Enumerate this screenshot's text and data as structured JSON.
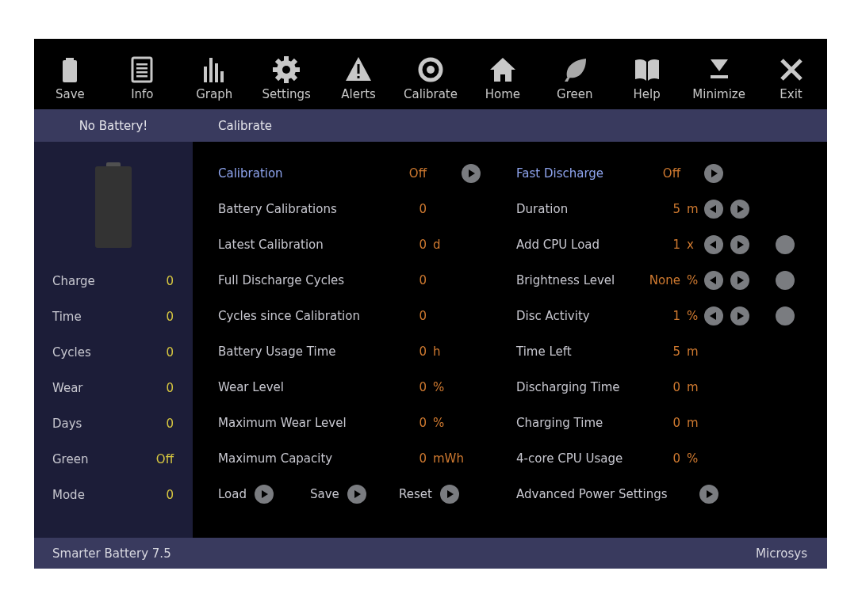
{
  "toolbar": [
    {
      "label": "Save"
    },
    {
      "label": "Info"
    },
    {
      "label": "Graph"
    },
    {
      "label": "Settings"
    },
    {
      "label": "Alerts"
    },
    {
      "label": "Calibrate"
    },
    {
      "label": "Home"
    },
    {
      "label": "Green"
    },
    {
      "label": "Help"
    },
    {
      "label": "Minimize"
    },
    {
      "label": "Exit"
    }
  ],
  "header": {
    "status": "No Battery!",
    "section": "Calibrate"
  },
  "sidebar": [
    {
      "label": "Charge",
      "value": "0"
    },
    {
      "label": "Time",
      "value": "0"
    },
    {
      "label": "Cycles",
      "value": "0"
    },
    {
      "label": "Wear",
      "value": "0"
    },
    {
      "label": "Days",
      "value": "0"
    },
    {
      "label": "Green",
      "value": "Off"
    },
    {
      "label": "Mode",
      "value": "0"
    }
  ],
  "left_rows": [
    {
      "kind": "link",
      "label": "Calibration",
      "value": "Off",
      "go": true
    },
    {
      "kind": "stat",
      "label": "Battery Calibrations",
      "value": "0"
    },
    {
      "kind": "stat",
      "label": "Latest Calibration",
      "value": "0",
      "unit": "d"
    },
    {
      "kind": "stat",
      "label": "Full Discharge Cycles",
      "value": "0"
    },
    {
      "kind": "stat",
      "label": "Cycles since Calibration",
      "value": "0"
    },
    {
      "kind": "stat",
      "label": "Battery Usage Time",
      "value": "0",
      "unit": "h"
    },
    {
      "kind": "stat",
      "label": "Wear Level",
      "value": "0",
      "unit": "%"
    },
    {
      "kind": "stat",
      "label": "Maximum Wear Level",
      "value": "0",
      "unit": "%"
    },
    {
      "kind": "stat",
      "label": "Maximum Capacity",
      "value": "0",
      "unit": "mWh"
    },
    {
      "kind": "actions",
      "items": [
        {
          "label": "Load"
        },
        {
          "label": "Save"
        },
        {
          "label": "Reset"
        }
      ]
    }
  ],
  "right_rows": [
    {
      "kind": "link",
      "label": "Fast Discharge",
      "value": "Off",
      "go": true
    },
    {
      "kind": "stat",
      "label": "Duration",
      "value": "5",
      "unit": "m",
      "stepper": true
    },
    {
      "kind": "stat",
      "label": "Add CPU Load",
      "value": "1",
      "unit": "x",
      "stepper": true,
      "indicator": true
    },
    {
      "kind": "stat",
      "label": "Brightness Level",
      "value": "None",
      "unit": "%",
      "stepper": true,
      "indicator": true
    },
    {
      "kind": "stat",
      "label": "Disc Activity",
      "value": "1",
      "unit": "%",
      "stepper": true,
      "indicator": true
    },
    {
      "kind": "stat",
      "label": "Time Left",
      "value": "5",
      "unit": "m"
    },
    {
      "kind": "stat",
      "label": "Discharging Time",
      "value": "0",
      "unit": "m"
    },
    {
      "kind": "stat",
      "label": "Charging Time",
      "value": "0",
      "unit": "m"
    },
    {
      "kind": "stat",
      "label": "4-core CPU Usage",
      "value": "0",
      "unit": "%"
    },
    {
      "kind": "action",
      "label": "Advanced Power Settings"
    }
  ],
  "footer": {
    "app": "Smarter Battery 7.5",
    "vendor": "Microsys"
  }
}
